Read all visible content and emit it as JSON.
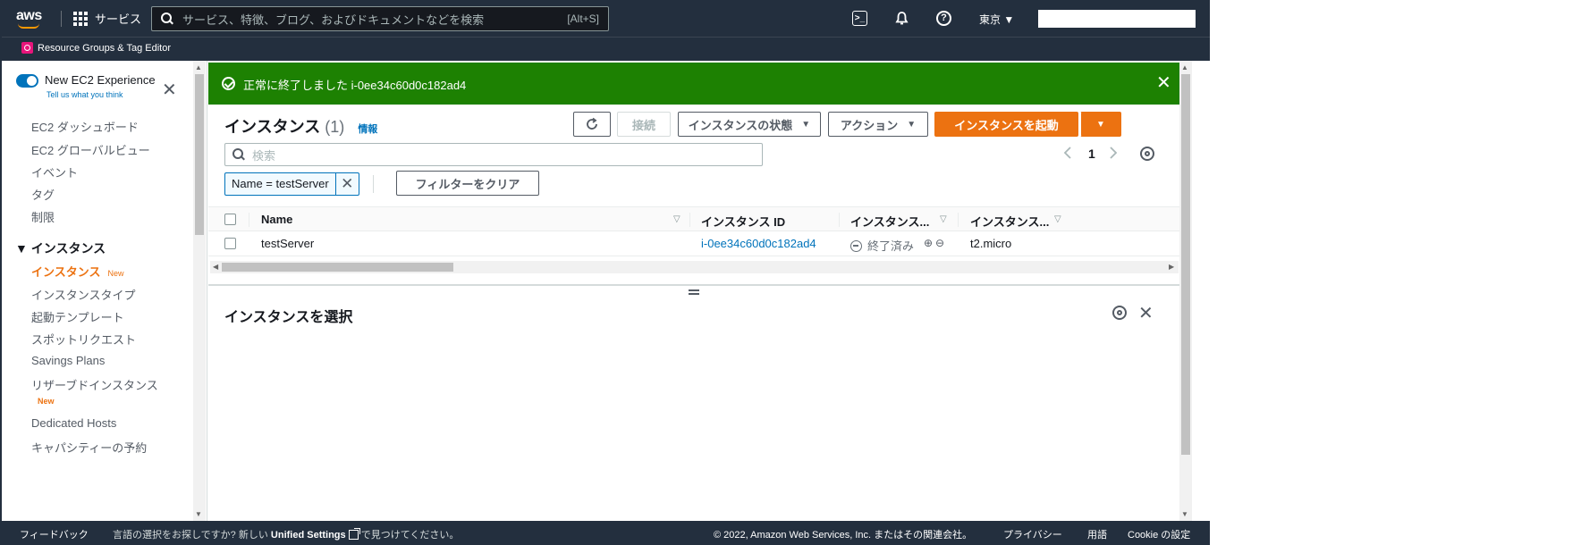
{
  "topnav": {
    "logo": "aws",
    "services_label": "サービス",
    "search_placeholder": "サービス、特徴、ブログ、およびドキュメントなどを検索",
    "search_shortcut": "[Alt+S]",
    "region": "東京 ▼"
  },
  "subbar": {
    "resource_groups": "Resource Groups & Tag Editor"
  },
  "sidebar": {
    "experience_title": "New EC2 Experience",
    "experience_sub": "Tell us what you think",
    "items_top": [
      "EC2 ダッシュボード",
      "EC2 グローバルビュー",
      "イベント",
      "タグ",
      "制限"
    ],
    "section_instances": "▼ インスタンス",
    "instances_active": "インスタンス",
    "new_badge": "New",
    "items_instances": [
      "インスタンスタイプ",
      "起動テンプレート",
      "スポットリクエスト",
      "Savings Plans",
      "リザーブドインスタンス"
    ],
    "reserved_new_badge": "New",
    "items_bottom": [
      "Dedicated Hosts",
      "キャパシティーの予約"
    ]
  },
  "flash": {
    "message": "正常に終了しました i-0ee34c60d0c182ad4"
  },
  "panel": {
    "title": "インスタンス",
    "count": "(1)",
    "info": "情報",
    "btn_connect": "接続",
    "btn_state": "インスタンスの状態",
    "btn_actions": "アクション",
    "btn_launch": "インスタンスを起動",
    "search_placeholder": "検索",
    "page_number": "1",
    "filter_token": "Name = testServer",
    "clear_filters": "フィルターをクリア"
  },
  "table": {
    "headers": [
      "Name",
      "インスタンス ID",
      "インスタンス...",
      "インスタンス..."
    ],
    "rows": [
      {
        "name": "testServer",
        "instance_id": "i-0ee34c60d0c182ad4",
        "state": "終了済み",
        "type": "t2.micro"
      }
    ]
  },
  "detail": {
    "title": "インスタンスを選択"
  },
  "footer": {
    "feedback": "フィードバック",
    "lang_prefix": "言語の選択をお探しですか? 新しい",
    "unified_settings": "Unified Settings",
    "lang_suffix": "で見つけてください。",
    "copyright": "© 2022, Amazon Web Services, Inc. またはその関連会社。",
    "privacy": "プライバシー",
    "terms": "用語",
    "cookie": "Cookie の設定"
  },
  "colors": {
    "nav_bg": "#232f3e",
    "flash_success": "#1d8102",
    "primary_orange": "#ec7211",
    "link_blue": "#0073bb"
  }
}
